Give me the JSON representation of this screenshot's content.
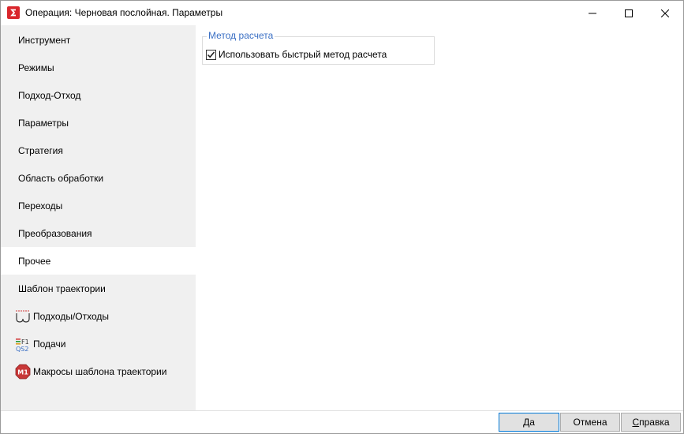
{
  "window": {
    "title": "Операция: Черновая послойная. Параметры"
  },
  "sidebar": {
    "items": [
      {
        "label": "Инструмент",
        "icon": "",
        "active": false
      },
      {
        "label": "Режимы",
        "icon": "",
        "active": false
      },
      {
        "label": "Подход-Отход",
        "icon": "",
        "active": false
      },
      {
        "label": "Параметры",
        "icon": "",
        "active": false
      },
      {
        "label": "Стратегия",
        "icon": "",
        "active": false
      },
      {
        "label": "Область обработки",
        "icon": "",
        "active": false
      },
      {
        "label": "Переходы",
        "icon": "",
        "active": false
      },
      {
        "label": "Преобразования",
        "icon": "",
        "active": false
      },
      {
        "label": "Прочее",
        "icon": "",
        "active": true
      },
      {
        "label": "Шаблон траектории",
        "icon": "",
        "active": false
      },
      {
        "label": "Подходы/Отходы",
        "icon": "approach-retract-icon",
        "active": false
      },
      {
        "label": "Подачи",
        "icon": "feeds-icon",
        "active": false
      },
      {
        "label": "Макросы шаблона траектории",
        "icon": "macro-m1-icon",
        "active": false
      }
    ]
  },
  "content": {
    "group_title": "Метод расчета",
    "checkbox_label": "Использовать быстрый метод расчета",
    "checkbox_checked": true
  },
  "footer": {
    "ok_first": "Д",
    "ok_rest": "а",
    "cancel": "Отмена",
    "help_first": "С",
    "help_rest": "правка"
  },
  "colors": {
    "accent": "#3a6fc4",
    "app_icon": "#d9262c",
    "sidebar_bg": "#f0f0f0"
  }
}
